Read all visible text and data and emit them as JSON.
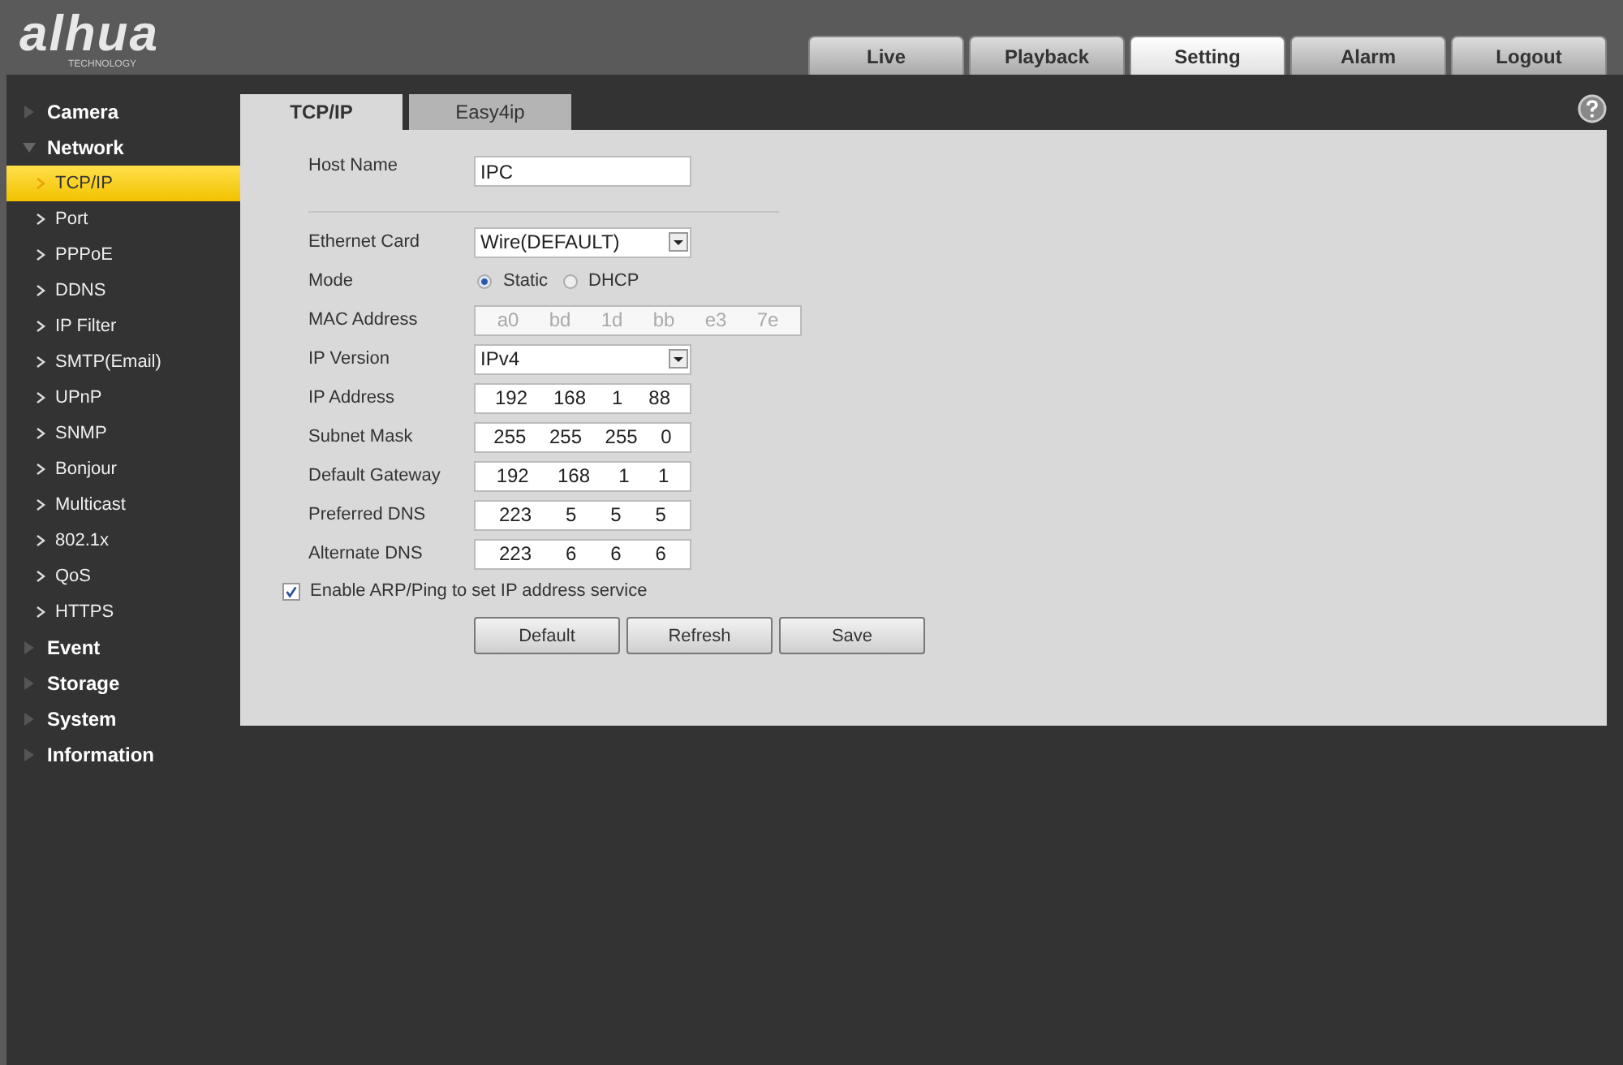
{
  "logo": {
    "brand": "alhua",
    "tagline": "TECHNOLOGY"
  },
  "nav_tabs": [
    {
      "label": "Live",
      "selected": false
    },
    {
      "label": "Playback",
      "selected": false
    },
    {
      "label": "Setting",
      "selected": true
    },
    {
      "label": "Alarm",
      "selected": false
    },
    {
      "label": "Logout",
      "selected": false
    }
  ],
  "sidebar": {
    "items": [
      {
        "label": "Camera",
        "expanded": false,
        "selected": false
      },
      {
        "label": "Network",
        "expanded": true,
        "selected": false,
        "children": [
          {
            "label": "TCP/IP",
            "selected": true
          },
          {
            "label": "Port",
            "selected": false
          },
          {
            "label": "PPPoE",
            "selected": false
          },
          {
            "label": "DDNS",
            "selected": false
          },
          {
            "label": "IP Filter",
            "selected": false
          },
          {
            "label": "SMTP(Email)",
            "selected": false
          },
          {
            "label": "UPnP",
            "selected": false
          },
          {
            "label": "SNMP",
            "selected": false
          },
          {
            "label": "Bonjour",
            "selected": false
          },
          {
            "label": "Multicast",
            "selected": false
          },
          {
            "label": "802.1x",
            "selected": false
          },
          {
            "label": "QoS",
            "selected": false
          },
          {
            "label": "HTTPS",
            "selected": false
          }
        ]
      },
      {
        "label": "Event",
        "expanded": false,
        "selected": false
      },
      {
        "label": "Storage",
        "expanded": false,
        "selected": false
      },
      {
        "label": "System",
        "expanded": false,
        "selected": false
      },
      {
        "label": "Information",
        "expanded": false,
        "selected": false
      }
    ]
  },
  "content_tabs": [
    {
      "label": "TCP/IP",
      "selected": true
    },
    {
      "label": "Easy4ip",
      "selected": false
    }
  ],
  "form": {
    "fields": [
      {
        "kind": "text",
        "label": "Host Name",
        "value": "IPC"
      },
      {
        "kind": "select",
        "label": "Ethernet Card",
        "value": "Wire(DEFAULT)"
      },
      {
        "kind": "radio",
        "label": "Mode",
        "options": [
          {
            "label": "Static",
            "selected": true
          },
          {
            "label": "DHCP",
            "selected": false
          }
        ]
      },
      {
        "kind": "mac",
        "label": "MAC Address",
        "disabled": true,
        "parts": [
          "a0",
          "bd",
          "1d",
          "bb",
          "e3",
          "7e"
        ]
      },
      {
        "kind": "select",
        "label": "IP Version",
        "value": "IPv4"
      },
      {
        "kind": "ip",
        "label": "IP Address",
        "parts": [
          "192",
          "168",
          "1",
          "88"
        ]
      },
      {
        "kind": "ip",
        "label": "Subnet Mask",
        "parts": [
          "255",
          "255",
          "255",
          "0"
        ]
      },
      {
        "kind": "ip",
        "label": "Default Gateway",
        "parts": [
          "192",
          "168",
          "1",
          "1"
        ]
      },
      {
        "kind": "ip",
        "label": "Preferred DNS",
        "parts": [
          "223",
          "5",
          "5",
          "5"
        ]
      },
      {
        "kind": "ip",
        "label": "Alternate DNS",
        "parts": [
          "223",
          "6",
          "6",
          "6"
        ]
      }
    ],
    "checkbox": {
      "label": "Enable ARP/Ping to set IP address service",
      "checked": true
    },
    "buttons": [
      "Default",
      "Refresh",
      "Save"
    ]
  }
}
